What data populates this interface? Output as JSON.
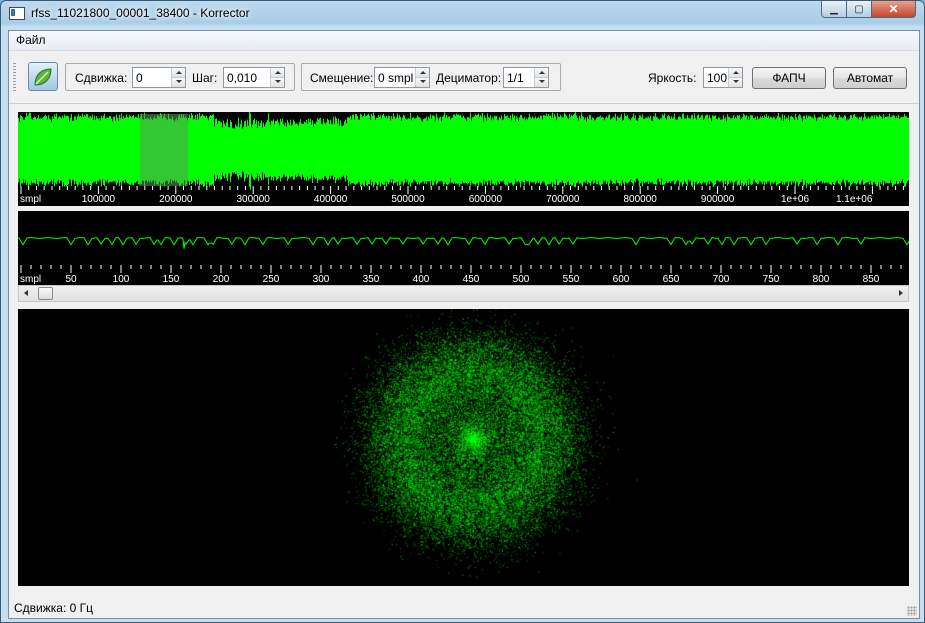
{
  "window": {
    "title": "rfss_11021800_00001_38400 - Korrector"
  },
  "menu": {
    "file": "Файл"
  },
  "toolbar": {
    "shift_label": "Сдвижка:",
    "shift_value": "0",
    "step_label": "Шаг:",
    "step_value": "0,010",
    "offset_label": "Смещение:",
    "offset_value": "0 smpl",
    "decimator_label": "Дециматор:",
    "decimator_value": "1/1",
    "brightness_label": "Яркость:",
    "brightness_value": "100",
    "pll_button": "ФАПЧ",
    "auto_button": "Автомат",
    "leaf_icon": "leaf-icon"
  },
  "waveform_overview": {
    "axis_unit": "smpl",
    "tick_labels": [
      "100000",
      "200000",
      "300000",
      "400000",
      "500000",
      "600000",
      "700000",
      "800000",
      "900000",
      "1e+06",
      "1.1e+06"
    ],
    "color": "#00ff00"
  },
  "waveform_detail": {
    "axis_unit": "smpl",
    "tick_labels": [
      "50",
      "100",
      "150",
      "200",
      "250",
      "300",
      "350",
      "400",
      "450",
      "500",
      "550",
      "600",
      "650",
      "700",
      "750",
      "800",
      "850"
    ],
    "color": "#00ff00"
  },
  "constellation": {
    "color": "#00ff00"
  },
  "status": {
    "text": "Сдвижка: 0 Гц"
  }
}
